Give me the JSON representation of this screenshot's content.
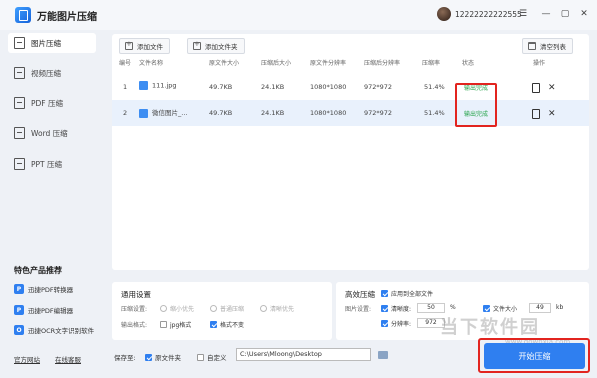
{
  "app": {
    "title": "万能图片压缩",
    "username": "12222222222555",
    "window_controls": [
      "menu-icon",
      "minimize-icon",
      "maximize-icon",
      "close-icon"
    ]
  },
  "sidebar": {
    "items": [
      {
        "label": "图片压缩",
        "icon": "image-icon",
        "active": true
      },
      {
        "label": "视频压缩",
        "icon": "video-icon",
        "active": false
      },
      {
        "label": "PDF 压缩",
        "icon": "pdf-icon",
        "active": false
      },
      {
        "label": "Word 压缩",
        "icon": "word-icon",
        "active": false
      },
      {
        "label": "PPT 压缩",
        "icon": "ppt-icon",
        "active": false
      }
    ],
    "products_title": "特色产品推荐",
    "products": [
      {
        "label": "迅捷PDF转换器",
        "icon": "pdf-converter-icon"
      },
      {
        "label": "迅捷PDF编辑器",
        "icon": "pdf-editor-icon"
      },
      {
        "label": "迅捷OCR文字识别软件",
        "icon": "ocr-icon"
      }
    ],
    "footer_links": [
      "官方网站",
      "在线客服"
    ]
  },
  "toolbar": {
    "add_file": "添加文件",
    "add_folder": "添加文件夹",
    "clear_list": "清空列表"
  },
  "table": {
    "columns": [
      "编号",
      "文件名称",
      "原文件大小",
      "压缩后大小",
      "原文件分辨率",
      "压缩后分辨率",
      "压缩率",
      "状态",
      "操作"
    ],
    "rows": [
      {
        "index": "1",
        "name": "111.jpg",
        "orig_size": "49.7KB",
        "new_size": "24.1KB",
        "orig_res": "1080*1080",
        "new_res": "972*972",
        "ratio": "51.4%",
        "status": "输出完成"
      },
      {
        "index": "2",
        "name": "微信图片_...",
        "orig_size": "49.7KB",
        "new_size": "24.1KB",
        "orig_res": "1080*1080",
        "new_res": "972*972",
        "ratio": "51.4%",
        "status": "输出完成"
      }
    ],
    "status_color": "#26a34a"
  },
  "general_settings": {
    "title": "通用设置",
    "compress_label": "压缩设置:",
    "compress_options": [
      "缩小优先",
      "普通压缩",
      "清晰优先"
    ],
    "format_label": "输出格式:",
    "format_options": [
      {
        "label": "jpg格式",
        "checked": false
      },
      {
        "label": "格式不变",
        "checked": true
      }
    ]
  },
  "advanced": {
    "title": "高效压缩",
    "apply_all": "应用到全部文件",
    "image_settings": "图片设置:",
    "quality_label": "清晰度:",
    "quality_value": "50",
    "quality_unit": "%",
    "resolution_label": "分辨率:",
    "resolution_value": "972",
    "filesize_label": "文件大小",
    "filesize_value": "49",
    "filesize_unit": "kb"
  },
  "footer": {
    "save_to": "保存至:",
    "orig_folder": "原文件夹",
    "custom": "自定义",
    "path": "C:\\Users\\Mloong\\Desktop",
    "start": "开始压缩"
  },
  "watermark": {
    "text": "当下软件园",
    "sub": "www.downxia.com"
  },
  "colors": {
    "accent": "#2f7ff0",
    "highlight_border": "#e2241f",
    "row_alt": "#e9f1fc"
  }
}
